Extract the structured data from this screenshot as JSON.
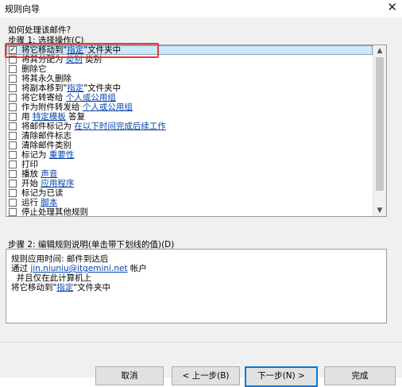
{
  "window": {
    "title": "规则向导",
    "close_glyph": "✕"
  },
  "question": "如何处理该邮件?",
  "step1_label": "步骤 1: 选择操作(C)",
  "actions": [
    {
      "checked": true,
      "parts": [
        {
          "t": "将它移动到\""
        },
        {
          "t": "指定",
          "link": true
        },
        {
          "t": "\"文件夹中"
        }
      ]
    },
    {
      "checked": false,
      "parts": [
        {
          "t": "将其分配为 "
        },
        {
          "t": "类别",
          "link": true
        },
        {
          "t": " 类别"
        }
      ]
    },
    {
      "checked": false,
      "parts": [
        {
          "t": "删除它"
        }
      ]
    },
    {
      "checked": false,
      "parts": [
        {
          "t": "将其永久删除"
        }
      ]
    },
    {
      "checked": false,
      "parts": [
        {
          "t": "将副本移到\""
        },
        {
          "t": "指定",
          "link": true
        },
        {
          "t": "\"文件夹中"
        }
      ]
    },
    {
      "checked": false,
      "parts": [
        {
          "t": "将它转寄给 "
        },
        {
          "t": "个人或公用组",
          "link": true
        }
      ]
    },
    {
      "checked": false,
      "parts": [
        {
          "t": "作为附件转发给 "
        },
        {
          "t": "个人或公用组",
          "link": true
        }
      ]
    },
    {
      "checked": false,
      "parts": [
        {
          "t": "用 "
        },
        {
          "t": "特定模板",
          "link": true
        },
        {
          "t": " 答复"
        }
      ]
    },
    {
      "checked": false,
      "parts": [
        {
          "t": "将邮件标记为 "
        },
        {
          "t": "在以下时间完成后续工作",
          "link": true
        }
      ]
    },
    {
      "checked": false,
      "parts": [
        {
          "t": "清除邮件标志"
        }
      ]
    },
    {
      "checked": false,
      "parts": [
        {
          "t": "清除邮件类别"
        }
      ]
    },
    {
      "checked": false,
      "parts": [
        {
          "t": "标记为 "
        },
        {
          "t": "重要性",
          "link": true
        }
      ]
    },
    {
      "checked": false,
      "parts": [
        {
          "t": "打印"
        }
      ]
    },
    {
      "checked": false,
      "parts": [
        {
          "t": "播放 "
        },
        {
          "t": "声音",
          "link": true
        }
      ]
    },
    {
      "checked": false,
      "parts": [
        {
          "t": "开始 "
        },
        {
          "t": "应用程序",
          "link": true
        }
      ]
    },
    {
      "checked": false,
      "parts": [
        {
          "t": "标记为已读"
        }
      ]
    },
    {
      "checked": false,
      "parts": [
        {
          "t": "运行 "
        },
        {
          "t": "脚本",
          "link": true
        }
      ]
    },
    {
      "checked": false,
      "parts": [
        {
          "t": "停止处理其他规则"
        }
      ]
    }
  ],
  "scroll": {
    "up": "▲",
    "down": "▼"
  },
  "check_glyph": "✓",
  "step2_label": "步骤 2: 编辑规则说明(单击带下划线的值)(D)",
  "description": [
    {
      "parts": [
        {
          "t": "规则应用时间: 邮件到达后"
        }
      ]
    },
    {
      "parts": [
        {
          "t": "通过 "
        },
        {
          "t": "jin.niuniu@itgemini.net",
          "link": true
        },
        {
          "t": " 帐户"
        }
      ]
    },
    {
      "parts": [
        {
          "t": "  并且仅在此计算机上"
        }
      ]
    },
    {
      "parts": [
        {
          "t": "将它移动到\""
        },
        {
          "t": "指定",
          "link": true
        },
        {
          "t": "\"文件夹中"
        }
      ]
    }
  ],
  "buttons": {
    "cancel": "取消",
    "back": "< 上一步(B)",
    "next": "下一步(N) >",
    "finish": "完成"
  }
}
